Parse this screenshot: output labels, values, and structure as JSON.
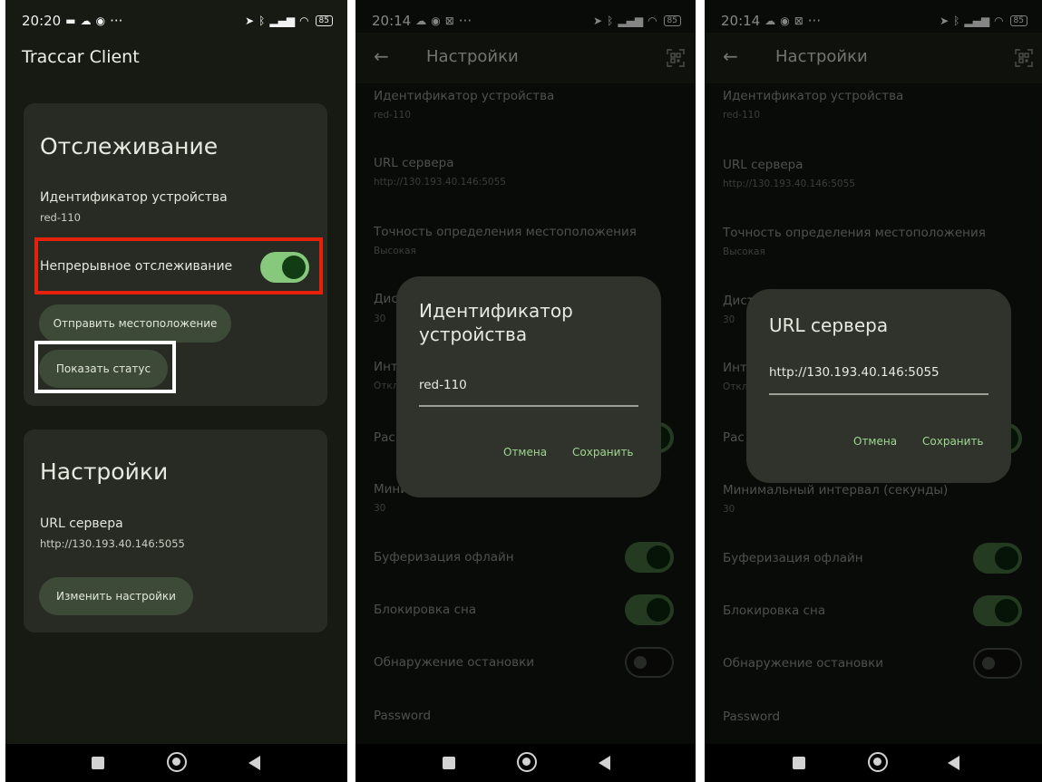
{
  "screen1": {
    "status": {
      "time": "20:20",
      "more": "···",
      "battery": "85"
    },
    "app_title": "Traccar Client",
    "tracking_card": {
      "title": "Отслеживание",
      "device_id_label": "Идентификатор устройства",
      "device_id_value": "red-110",
      "continuous_label": "Непрерывное отслеживание",
      "continuous_enabled": true,
      "send_location_button": "Отправить местоположение",
      "show_status_button": "Показать статус"
    },
    "settings_card": {
      "title": "Настройки",
      "server_url_label": "URL сервера",
      "server_url_value": "http://130.193.40.146:5055",
      "change_settings_button": "Изменить настройки"
    },
    "highlight_colors": {
      "red": "#e5210c",
      "white": "#ffffff"
    }
  },
  "screen2": {
    "status": {
      "time": "20:14",
      "more": "···",
      "battery": "85"
    },
    "appbar_title": "Настройки",
    "settings": [
      {
        "label": "Идентификатор устройства",
        "value": "red-110"
      },
      {
        "label": "URL сервера",
        "value": "http://130.193.40.146:5055"
      },
      {
        "label": "Точность определения местоположения",
        "value": "Высокая"
      },
      {
        "label": "Дис",
        "value": "30"
      },
      {
        "label": "Инт",
        "value": "Откл"
      },
      {
        "label": "Рас"
      },
      {
        "label": "Мини",
        "value": "30"
      },
      {
        "label": "Буферизация офлайн"
      },
      {
        "label": "Блокировка сна"
      },
      {
        "label": "Обнаружение остановки"
      },
      {
        "label": "Password"
      }
    ],
    "toggles": {
      "buffering": true,
      "wake_lock": true,
      "stop_detection": false
    },
    "dialog": {
      "title_line1": "Идентификатор",
      "title_line2": "устройства",
      "input_value": "red-110",
      "cancel_label": "Отмена",
      "save_label": "Сохранить"
    }
  },
  "screen3": {
    "status": {
      "time": "20:14",
      "more": "···",
      "battery": "85"
    },
    "appbar_title": "Настройки",
    "settings": [
      {
        "label": "Идентификатор устройства",
        "value": "red-110"
      },
      {
        "label": "URL сервера",
        "value": "http://130.193.40.146:5055"
      },
      {
        "label": "Точность определения местоположения",
        "value": "Высокая"
      },
      {
        "label": "Дист",
        "value": "30"
      },
      {
        "label": "Инт",
        "value": "Откл"
      },
      {
        "label": "Рас"
      },
      {
        "label": "Минимальный интервал (секунды)",
        "value": "30"
      },
      {
        "label": "Буферизация офлайн"
      },
      {
        "label": "Блокировка сна"
      },
      {
        "label": "Обнаружение остановки"
      },
      {
        "label": "Password"
      }
    ],
    "toggles": {
      "buffering": true,
      "wake_lock": true,
      "stop_detection": false
    },
    "dialog": {
      "title": "URL сервера",
      "input_value": "http://130.193.40.146:5055",
      "cancel_label": "Отмена",
      "save_label": "Сохранить"
    }
  },
  "accent_color": "#86c97c"
}
